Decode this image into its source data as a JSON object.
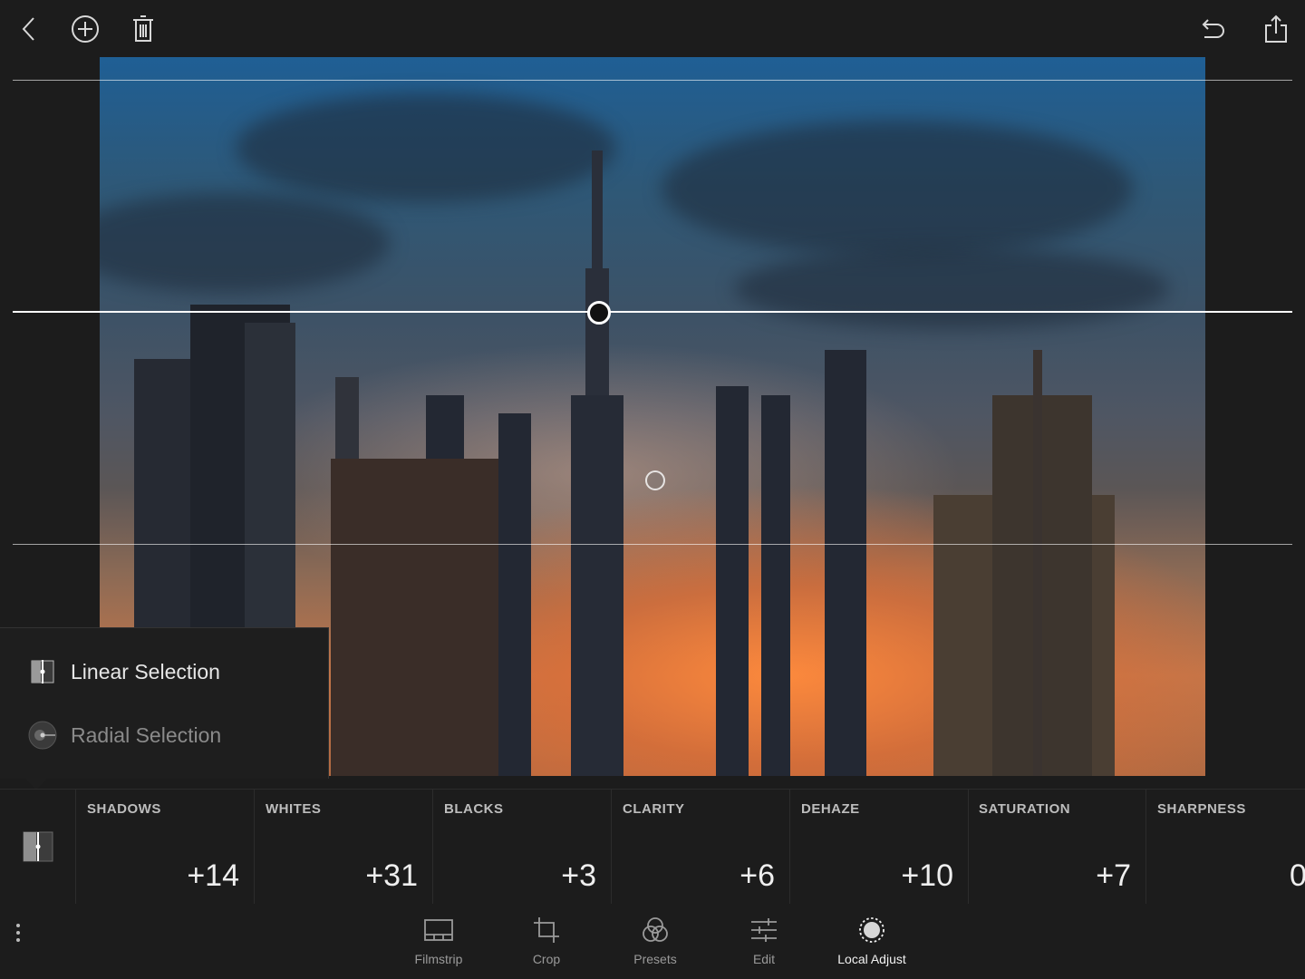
{
  "topbar": {
    "left_icons": [
      "back-icon",
      "add-icon",
      "trash-icon"
    ],
    "right_icons": [
      "undo-icon",
      "share-icon"
    ]
  },
  "selection_menu": {
    "items": [
      {
        "label": "Linear Selection",
        "icon": "linear-selection-icon",
        "active": true
      },
      {
        "label": "Radial Selection",
        "icon": "radial-selection-icon",
        "active": false
      }
    ]
  },
  "adjustments": [
    {
      "name": "SHADOWS",
      "value": "+14"
    },
    {
      "name": "WHITES",
      "value": "+31"
    },
    {
      "name": "BLACKS",
      "value": "+3"
    },
    {
      "name": "CLARITY",
      "value": "+6"
    },
    {
      "name": "DEHAZE",
      "value": "+10"
    },
    {
      "name": "SATURATION",
      "value": "+7"
    },
    {
      "name": "SHARPNESS",
      "value": "0"
    }
  ],
  "toolbar": {
    "items": [
      {
        "label": "Filmstrip",
        "icon": "filmstrip-icon",
        "active": false
      },
      {
        "label": "Crop",
        "icon": "crop-icon",
        "active": false
      },
      {
        "label": "Presets",
        "icon": "presets-icon",
        "active": false
      },
      {
        "label": "Edit",
        "icon": "edit-sliders-icon",
        "active": false
      },
      {
        "label": "Local Adjust",
        "icon": "local-adjust-icon",
        "active": true
      }
    ]
  },
  "colors": {
    "background": "#1c1c1c",
    "panel": "#1e1e1e",
    "text_active": "#f2f2f2",
    "text_inactive": "#9a9a9a"
  }
}
